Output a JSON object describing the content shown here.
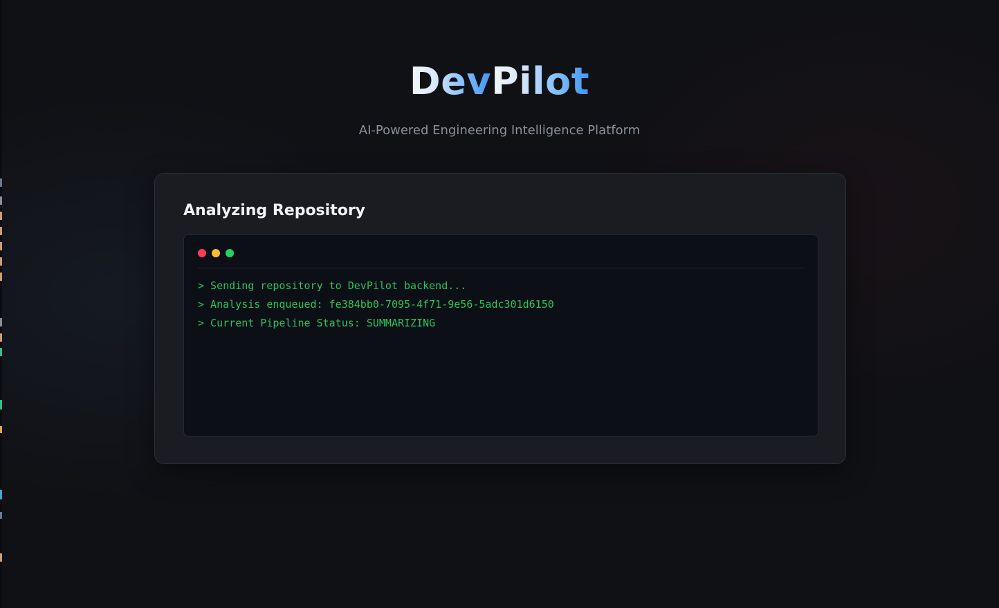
{
  "header": {
    "brand_part1": "Dev",
    "brand_part2": "Pilot",
    "tagline": "AI-Powered Engineering Intelligence Platform"
  },
  "card": {
    "title": "Analyzing Repository",
    "terminal": {
      "window_controls": [
        "close-dot",
        "minimize-dot",
        "maximize-dot"
      ],
      "lines": [
        "> Sending repository to DevPilot backend...",
        "> Analysis enqueued: fe384bb0-7095-4f71-9e56-5adc301d6150",
        "> Current Pipeline Status: SUMMARIZING"
      ]
    }
  },
  "colors": {
    "background": "#101115",
    "card": "#1a1c22",
    "terminal": "#0c0f15",
    "terminal_text": "#28c45e",
    "brand_accent": "#3f93f2",
    "dot_red": "#ff3b55",
    "dot_yellow": "#febc2e",
    "dot_green": "#1ed65f"
  }
}
